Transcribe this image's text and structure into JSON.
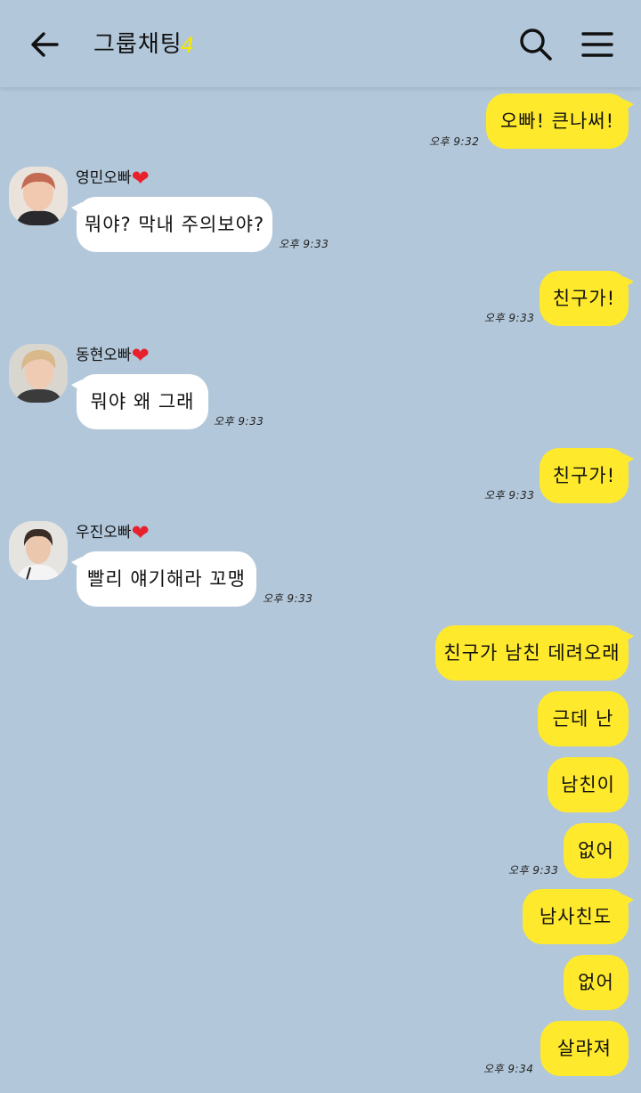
{
  "header": {
    "title": "그룹채팅",
    "member_count": "4"
  },
  "messages": [
    {
      "from": "me",
      "text": "오빠! 큰나써!",
      "time": "오후 9:32"
    },
    {
      "from": "영민오빠",
      "text": "뭐야? 막내 주의보야?",
      "time": "오후 9:33"
    },
    {
      "from": "me",
      "text": "친구가!",
      "time": "오후 9:33"
    },
    {
      "from": "동현오빠",
      "text": "뭐야 왜 그래",
      "time": "오후 9:33"
    },
    {
      "from": "me",
      "text": "친구가!",
      "time": "오후 9:33"
    },
    {
      "from": "우진오빠",
      "text": "빨리 얘기해라 꼬맹",
      "time": "오후 9:33"
    },
    {
      "from": "me",
      "text": "친구가 남친 데려오래"
    },
    {
      "from": "me",
      "text": "근데 난"
    },
    {
      "from": "me",
      "text": "남친이"
    },
    {
      "from": "me",
      "text": "없어",
      "time": "오후 9:33"
    },
    {
      "from": "me",
      "text": "남사친도"
    },
    {
      "from": "me",
      "text": "없어"
    },
    {
      "from": "me",
      "text": "살랴져",
      "time": "오후 9:34"
    }
  ],
  "senders": {
    "youngmin": {
      "name": "영민오빠",
      "heart": "❤"
    },
    "donghyun": {
      "name": "동현오빠",
      "heart": "❤"
    },
    "woojin": {
      "name": "우진오빠",
      "heart": "❤"
    }
  },
  "colors": {
    "background": "#b2c7da",
    "my_bubble": "#fee92c",
    "their_bubble": "#ffffff",
    "member_count": "#f7e600",
    "heart": "#e8202c"
  },
  "icons": [
    "back-arrow-icon",
    "search-icon",
    "menu-icon"
  ]
}
